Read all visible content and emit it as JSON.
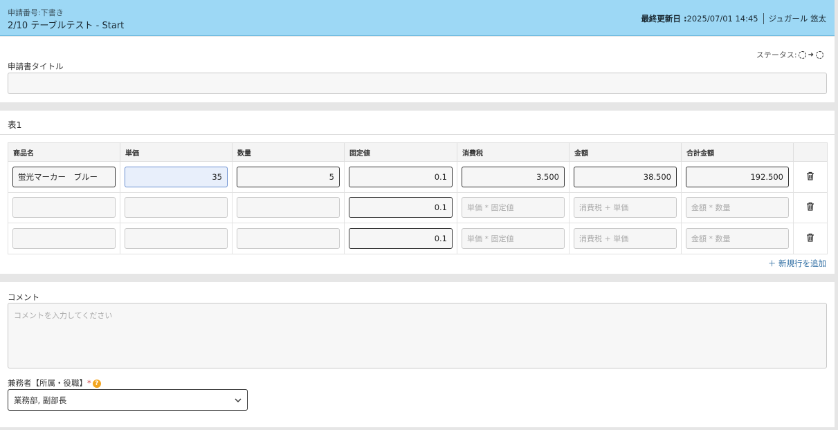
{
  "header": {
    "subtitle": "申請番号:下書き",
    "title": "2/10 テーブルテスト - Start",
    "last_updated_label": "最終更新日 :",
    "last_updated_value": "2025/07/01 14:45",
    "user_name": "ジュガール 悠太"
  },
  "form": {
    "status_label": "ステータス:",
    "title_label": "申請書タイトル",
    "title_value": ""
  },
  "table": {
    "title": "表1",
    "columns": [
      "商品名",
      "単価",
      "数量",
      "固定値",
      "消費税",
      "金額",
      "合計金額"
    ],
    "rows": [
      {
        "name": "蛍光マーカー　ブルー",
        "unit_price": "35",
        "quantity": "5",
        "fixed": "0.1",
        "tax": "3.500",
        "amount": "38.500",
        "total": "192.500"
      },
      {
        "name": "",
        "unit_price": "",
        "quantity": "",
        "fixed": "0.1",
        "tax": "",
        "amount": "",
        "total": ""
      },
      {
        "name": "",
        "unit_price": "",
        "quantity": "",
        "fixed": "0.1",
        "tax": "",
        "amount": "",
        "total": ""
      }
    ],
    "placeholders": {
      "tax": "単価 * 固定値",
      "amount": "消費税 + 単価",
      "total": "金額 * 数量"
    },
    "add_row_label": "＋ 新規行を追加"
  },
  "comment": {
    "label": "コメント",
    "placeholder": "コメントを入力してください"
  },
  "assignee": {
    "label": "兼務者【所属・役職】",
    "required_mark": "*",
    "help_mark": "?",
    "selected": "業務部, 副部長"
  },
  "colors": {
    "header_bg": "#9dd8f5",
    "link": "#2f6ea3",
    "required": "#d24a4a",
    "help": "#f3a51f"
  }
}
